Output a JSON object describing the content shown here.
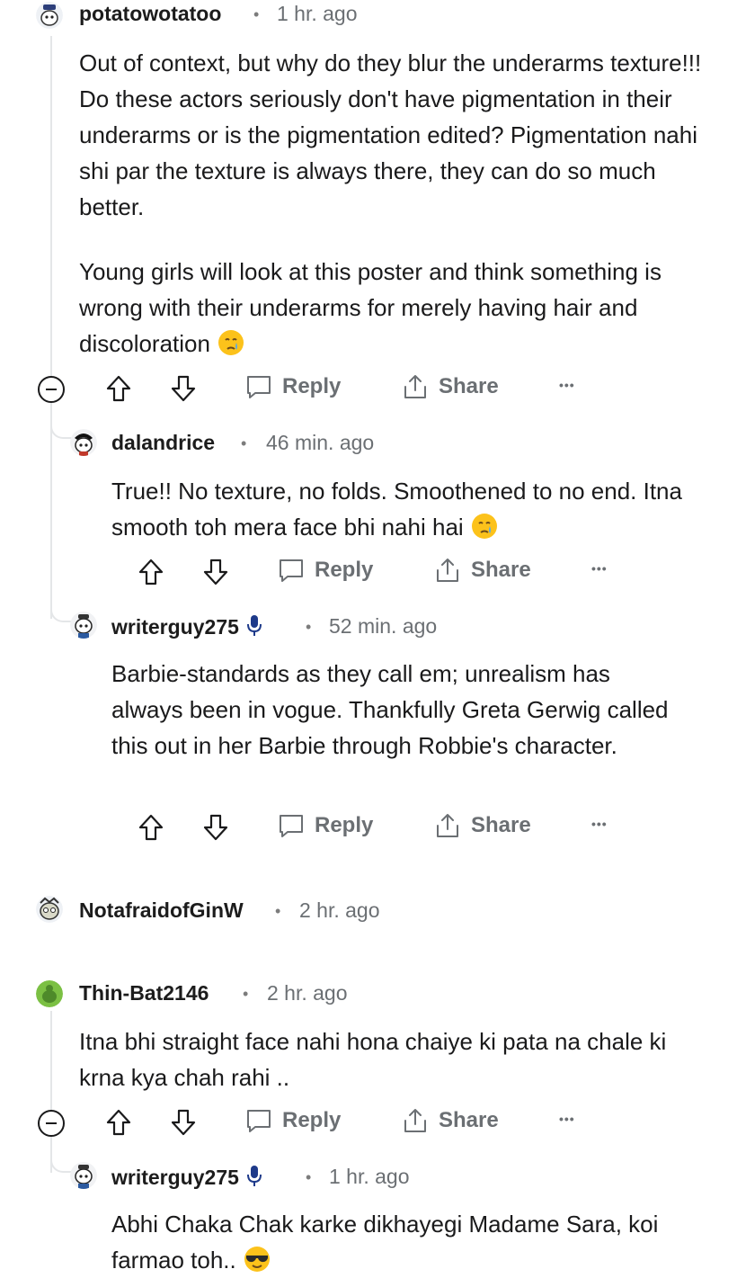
{
  "comments": [
    {
      "username": "potatowotatoo",
      "time": "1 hr. ago",
      "paragraphs": [
        "Out of context, but why do they blur the underarms texture!!! Do these actors seriously don't have pigmentation in their underarms or is the pigmentation edited? Pigmentation nahi shi par the texture is always there, they can do so much better.",
        "Young girls will look at this poster and think something is wrong with their underarms for merely having hair and discoloration"
      ],
      "emoji": "crying-face"
    },
    {
      "username": "dalandrice",
      "time": "46 min. ago",
      "text": "True!! No texture, no folds. Smoothened to no end. Itna smooth toh mera face bhi nahi hai",
      "emoji": "crying-face"
    },
    {
      "username": "writerguy275",
      "time": "52 min. ago",
      "text": "Barbie-standards as they call em; unrealism has always been in vogue. Thankfully Greta Gerwig called this out in her Barbie through Robbie's character."
    },
    {
      "username": "NotafraidofGinW",
      "time": "2 hr. ago"
    },
    {
      "username": "Thin-Bat2146",
      "time": "2 hr. ago",
      "text": "Itna bhi straight face nahi hona chaiye ki pata na chale ki krna kya chah rahi .."
    },
    {
      "username": "writerguy275",
      "time": "1 hr. ago",
      "text": "Abhi Chaka Chak karke dikhayegi Madame Sara, koi farmao toh..",
      "emoji": "sunglasses-face"
    }
  ],
  "actions": {
    "reply": "Reply",
    "share": "Share",
    "more": "•••"
  },
  "separator": "•",
  "colors": {
    "text": "#1a1a1b",
    "meta": "#6b6f73",
    "thread_line": "#e4e6e8",
    "mic_icon": "#1e3a8a",
    "avatar_green": "#7bc043"
  }
}
